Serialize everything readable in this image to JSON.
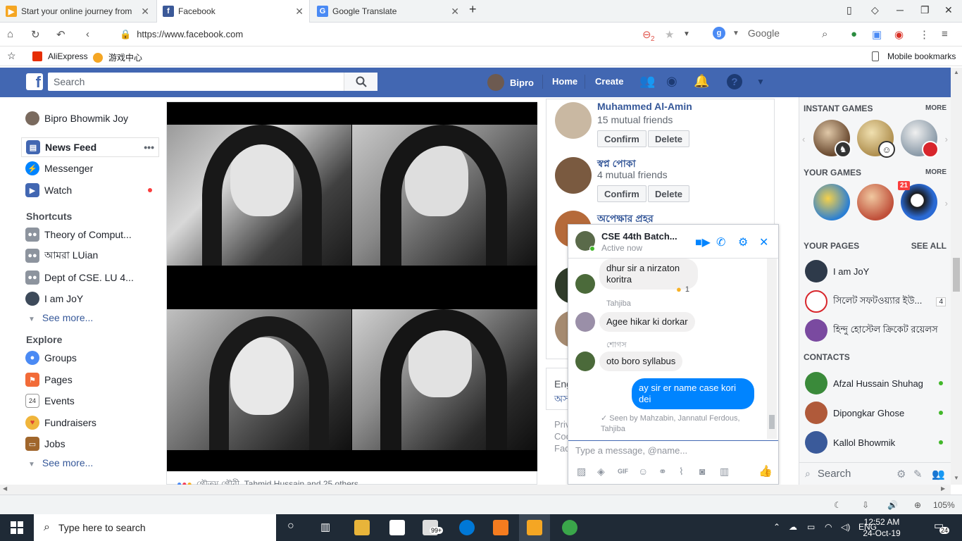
{
  "browser": {
    "tabs": [
      {
        "title": "Start your online journey from",
        "favicon_color": "#f5a623"
      },
      {
        "title": "Facebook",
        "favicon_color": "#3b5998"
      },
      {
        "title": "Google Translate",
        "favicon_color": "#4a8af4"
      }
    ],
    "url": "https://www.facebook.com",
    "blocked_count": "2",
    "search_engine_label": "Google",
    "bookmarks": [
      "AliExpress",
      "游戏中心"
    ],
    "mobile_bookmarks": "Mobile bookmarks",
    "zoom": "105%"
  },
  "fb_header": {
    "search_placeholder": "Search",
    "user": "Bipro",
    "home": "Home",
    "create": "Create"
  },
  "left_nav": {
    "profile": "Bipro Bhowmik Joy",
    "main": [
      {
        "label": "News Feed",
        "color": "#4267b2"
      },
      {
        "label": "Messenger",
        "color": "#0084ff"
      },
      {
        "label": "Watch",
        "color": "#4267b2"
      }
    ],
    "shortcuts_heading": "Shortcuts",
    "shortcuts": [
      "Theory of Comput...",
      "আমরা LUian",
      "Dept of CSE. LU 4...",
      "I am JoY"
    ],
    "see_more": "See more...",
    "explore_heading": "Explore",
    "explore": [
      {
        "label": "Groups",
        "color": "#4a8af4"
      },
      {
        "label": "Pages",
        "color": "#f26b38"
      },
      {
        "label": "Events",
        "color": "#e0e0e0"
      },
      {
        "label": "Fundraisers",
        "color": "#f0b53b"
      },
      {
        "label": "Jobs",
        "color": "#a0662c"
      }
    ]
  },
  "post": {
    "reactions_text": "গৌতম গৌরী, Tahmid Hussain and 25 others"
  },
  "friend_requests": [
    {
      "name": "Muhammed Al-Amin",
      "mutual": "15 mutual friends"
    },
    {
      "name": "স্বপ্ন পোকা",
      "mutual": "4 mutual friends"
    },
    {
      "name": "অপেক্ষার প্রহর",
      "mutual": ""
    }
  ],
  "buttons": {
    "confirm": "Confirm",
    "delete": "Delete"
  },
  "lang_card": {
    "line1": "Eng",
    "line2": "অস"
  },
  "footer": [
    "Priv",
    "Coo",
    "Fac"
  ],
  "chat": {
    "title": "CSE 44th Batch...",
    "status": "Active now",
    "messages": [
      {
        "sender": "",
        "text": "dhur sir a nirzaton koritra",
        "reaction": "1"
      },
      {
        "sender": "Tahjiba",
        "text": "Agee hikar ki dorkar"
      },
      {
        "sender": "শোগস",
        "text": "oto boro syllabus"
      },
      {
        "sender": "me",
        "text": "ay sir er name case kori dei"
      }
    ],
    "seen_by": "Seen by Mahzabin, Jannatul Ferdous, Tahjiba",
    "input_placeholder": "Type a message, @name..."
  },
  "right_bar": {
    "instant_games": "INSTANT GAMES",
    "your_games": "YOUR GAMES",
    "more": "MORE",
    "game_badge": "21",
    "your_pages": "YOUR PAGES",
    "see_all": "SEE ALL",
    "pages": [
      {
        "name": "I am JoY",
        "badge": ""
      },
      {
        "name": "সিলেট সফটওয়্যার ইউ...",
        "badge": "4"
      },
      {
        "name": "হিন্দু হোস্টেল ক্রিকেট রয়েলস",
        "badge": ""
      }
    ],
    "contacts_heading": "CONTACTS",
    "contacts": [
      "Afzal Hussain Shuhag",
      "Dipongkar Ghose",
      "Kallol Bhowmik"
    ],
    "search_label": "Search"
  },
  "taskbar": {
    "search_placeholder": "Type here to search",
    "mail_badge": "99+",
    "lang": "ENG",
    "time": "12:52 AM",
    "date": "24-Oct-19",
    "notif_count": "24"
  }
}
